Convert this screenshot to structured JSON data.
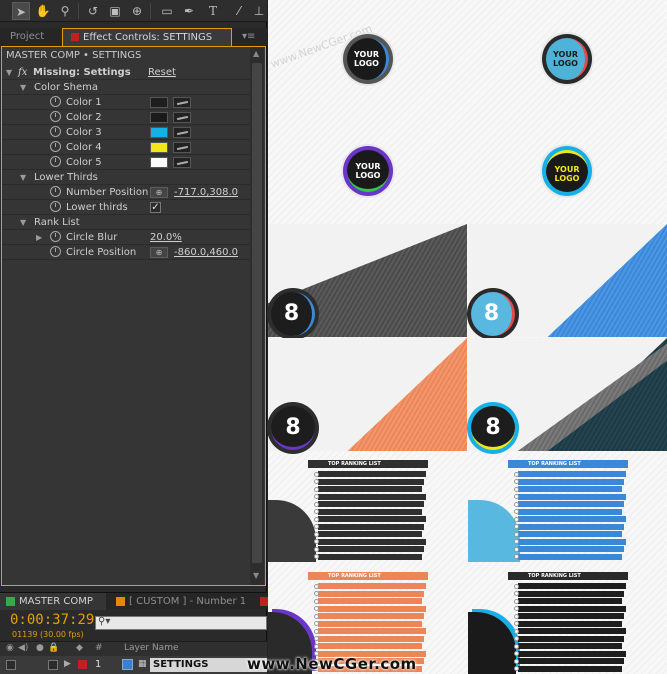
{
  "toolbar": {
    "tools": [
      "selection-tool",
      "hand-tool",
      "zoom-tool",
      "rotate-tool",
      "camera-tool",
      "pan-behind-tool",
      "rectangle-tool",
      "pen-tool",
      "type-tool",
      "brush-tool"
    ],
    "type_glyph": "T"
  },
  "tabs": {
    "project": "Project",
    "effect_controls": "Effect Controls: SETTINGS"
  },
  "effect_controls": {
    "comp_path": "MASTER COMP • SETTINGS",
    "fx_glyph": "fx",
    "effect_name": "Missing: Settings",
    "reset": "Reset",
    "groups": [
      {
        "name": "Color Shema"
      },
      {
        "name": "Lower Thirds"
      },
      {
        "name": "Rank List"
      }
    ],
    "colors": [
      {
        "label": "Color 1",
        "value": "#1e1e1e"
      },
      {
        "label": "Color 2",
        "value": "#1a1a1a"
      },
      {
        "label": "Color 3",
        "value": "#16b0e6"
      },
      {
        "label": "Color 4",
        "value": "#f2e61a"
      },
      {
        "label": "Color 5",
        "value": "#ffffff"
      }
    ],
    "number_position": {
      "label": "Number Position",
      "value": "-717.0,308.0"
    },
    "lower_thirds": {
      "label": "Lower thirds",
      "checked": true,
      "check_glyph": "✓"
    },
    "circle_blur": {
      "label": "Circle Blur",
      "value": "20.0%"
    },
    "circle_position": {
      "label": "Circle Position",
      "value": "-860.0,460.0"
    }
  },
  "timeline": {
    "tab_master": "MASTER COMP",
    "tab_custom": "[ CUSTOM ] - Number 1",
    "timecode": "0:00:37:29",
    "frames": "01139 (30.00 fps)",
    "search_placeholder": "",
    "hash_col": "#",
    "layer_name_col": "Layer Name",
    "layer": {
      "index": "1",
      "name": "SETTINGS"
    }
  },
  "preview": {
    "logo_text_1": "YOUR",
    "logo_text_2": "LOGO",
    "badge_number": "8",
    "rank_title": "TOP RANKING LIST",
    "rank_rows": 12
  },
  "watermark": "www.NewCGer.com",
  "accent_colors": {
    "orange": "#e0a000",
    "blue": "#3b88d8",
    "teal": "#1c3a45",
    "peach": "#ec8659"
  }
}
